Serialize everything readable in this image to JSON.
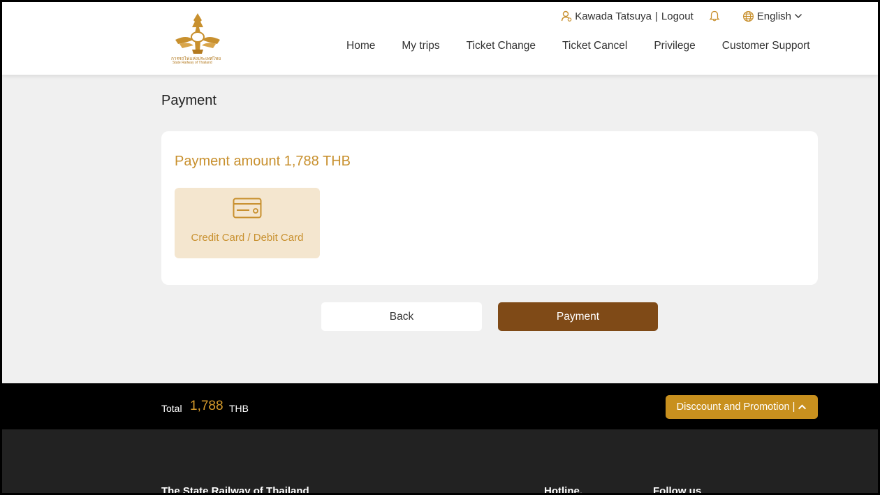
{
  "header": {
    "logo": {
      "org_text_thai": "การรถไฟแห่งประเทศไทย",
      "org_text_en": "State Railway of Thailand"
    },
    "user": {
      "name": "Kawada Tatsuya",
      "separator": "|",
      "logout": "Logout"
    },
    "language": {
      "selected": "English"
    },
    "nav": [
      "Home",
      "My trips",
      "Ticket Change",
      "Ticket Cancel",
      "Privilege",
      "Customer Support"
    ],
    "icons": {
      "user": "user-icon",
      "bell": "bell-icon",
      "globe": "globe-icon",
      "chevron": "chevron-down-icon"
    }
  },
  "main": {
    "title": "Payment",
    "payment_amount": "Payment amount 1,788 THB",
    "methods": [
      {
        "label": "Credit Card / Debit Card",
        "icon": "credit-card-icon"
      }
    ],
    "back_label": "Back",
    "pay_label": "Payment"
  },
  "total_bar": {
    "label": "Total",
    "value": "1,788",
    "currency": "THB",
    "promo_label": "Disccount and Promotion |",
    "promo_icon": "chevron-up-icon"
  },
  "footer": {
    "org": "The State Railway of Thailand",
    "hotline": "Hotline.",
    "follow": "Follow us"
  },
  "colors": {
    "gold": "#c8902e",
    "brown_button": "#7f4a17",
    "promo_button": "#c8901e",
    "method_bg": "#f4e6cf",
    "footer_bg": "#222222"
  }
}
